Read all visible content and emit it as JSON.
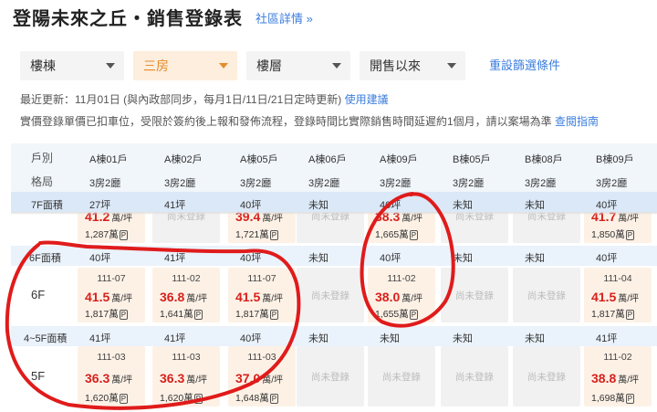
{
  "header": {
    "title": "登陽未來之丘・銷售登錄表",
    "detail_link": "社區詳情 »"
  },
  "filters": {
    "building": "樓棟",
    "layout": "三房",
    "floor": "樓層",
    "sale_period": "開售以來",
    "reset": "重設篩選條件"
  },
  "notes": {
    "update_text": "最近更新：11月01日 (與內政部同步，每月1日/11日/21日定時更新)",
    "update_link": "使用建議",
    "disclaimer_text": "實價登錄單價已扣車位，受限於簽約後上報和發佈流程，登錄時間比實際銷售時間延遲約1個月，請以案場為準",
    "disclaimer_link": "查閱指南"
  },
  "table": {
    "row_labels": {
      "unit": "戶別",
      "layout": "格局"
    },
    "units": [
      {
        "unit": "A棟01戶",
        "layout": "3房2廳"
      },
      {
        "unit": "A棟02戶",
        "layout": "3房2廳"
      },
      {
        "unit": "A棟05戶",
        "layout": "3房2廳"
      },
      {
        "unit": "A棟06戶",
        "layout": "3房2廳"
      },
      {
        "unit": "A棟09戶",
        "layout": "3房2廳"
      },
      {
        "unit": "B棟05戶",
        "layout": "3房2廳"
      },
      {
        "unit": "B棟08戶",
        "layout": "3房2廳"
      },
      {
        "unit": "B棟09戶",
        "layout": "3房2廳"
      }
    ],
    "sticky_area": {
      "label": "7F面積",
      "values": [
        "27坪",
        "41坪",
        "40坪",
        "未知",
        "40坪",
        "未知",
        "未知",
        "40坪"
      ]
    },
    "row7": [
      {
        "status": "sold",
        "price": "41.2",
        "unit_price": "萬/坪",
        "total": "1,287萬",
        "parking": "P"
      },
      {
        "status": "none",
        "text": "尚未登錄"
      },
      {
        "status": "sold",
        "price": "39.4",
        "unit_price": "萬/坪",
        "total": "1,721萬",
        "parking": "P"
      },
      {
        "status": "none",
        "text": "尚未登錄"
      },
      {
        "status": "sold",
        "price": "38.3",
        "unit_price": "萬/坪",
        "total": "1,665萬",
        "parking": "P"
      },
      {
        "status": "none",
        "text": "尚未登錄"
      },
      {
        "status": "none",
        "text": "尚未登錄"
      },
      {
        "status": "sold",
        "price": "41.7",
        "unit_price": "萬/坪",
        "total": "1,850萬",
        "parking": "P"
      }
    ],
    "area6": {
      "label": "6F面積",
      "values": [
        "40坪",
        "41坪",
        "40坪",
        "未知",
        "40坪",
        "未知",
        "未知",
        "40坪"
      ]
    },
    "floor6": {
      "label": "6F",
      "cells": [
        {
          "status": "sold",
          "date": "111-07",
          "price": "41.5",
          "unit_price": "萬/坪",
          "total": "1,817萬",
          "parking": "P"
        },
        {
          "status": "sold",
          "date": "111-02",
          "price": "36.8",
          "unit_price": "萬/坪",
          "total": "1,641萬",
          "parking": "P"
        },
        {
          "status": "sold",
          "date": "111-07",
          "price": "41.5",
          "unit_price": "萬/坪",
          "total": "1,817萬",
          "parking": "P"
        },
        {
          "status": "none",
          "text": "尚未登錄"
        },
        {
          "status": "sold",
          "date": "111-02",
          "price": "38.0",
          "unit_price": "萬/坪",
          "total": "1,655萬",
          "parking": "P"
        },
        {
          "status": "none",
          "text": "尚未登錄"
        },
        {
          "status": "none",
          "text": "尚未登錄"
        },
        {
          "status": "sold",
          "date": "111-04",
          "price": "41.5",
          "unit_price": "萬/坪",
          "total": "1,817萬",
          "parking": "P"
        }
      ]
    },
    "area45": {
      "label": "4~5F面積",
      "values": [
        "41坪",
        "41坪",
        "40坪",
        "未知",
        "未知",
        "未知",
        "未知",
        "41坪"
      ]
    },
    "floor5": {
      "label": "5F",
      "cells": [
        {
          "status": "sold",
          "date": "111-03",
          "price": "36.3",
          "unit_price": "萬/坪",
          "total": "1,620萬",
          "parking": "P"
        },
        {
          "status": "sold",
          "date": "111-03",
          "price": "36.3",
          "unit_price": "萬/坪",
          "total": "1,620萬",
          "parking": "P"
        },
        {
          "status": "sold",
          "date": "111-03",
          "price": "37.0",
          "unit_price": "萬/坪",
          "total": "1,648萬",
          "parking": "P"
        },
        {
          "status": "none",
          "text": "尚未登錄"
        },
        {
          "status": "none",
          "text": "尚未登錄"
        },
        {
          "status": "none",
          "text": "尚未登錄"
        },
        {
          "status": "none",
          "text": "尚未登錄"
        },
        {
          "status": "sold",
          "date": "111-02",
          "price": "38.8",
          "unit_price": "萬/坪",
          "total": "1,698萬",
          "parking": "P"
        }
      ]
    }
  },
  "colors": {
    "accent_link": "#3b7ddd",
    "price_red": "#d7211c",
    "sold_cell": "#fdf1e6",
    "empty_cell": "#f1f1f1",
    "ink_mark": "#e01b1b"
  }
}
